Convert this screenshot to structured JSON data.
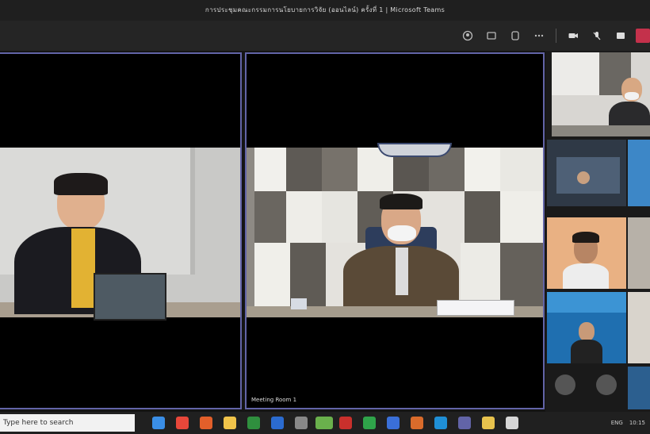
{
  "window": {
    "title": "การประชุมคณะกรรมการนโยบายการวิจัย (ออนไลน์) ครั้งที่ 1 | Microsoft Teams"
  },
  "toolbar": {
    "icons": [
      "participants-icon",
      "chat-icon",
      "reactions-icon",
      "more-icon",
      "camera-icon",
      "mic-icon",
      "share-icon",
      "leave-icon"
    ]
  },
  "main_tiles": [
    {
      "name": ""
    },
    {
      "name": "Meeting Room 1"
    }
  ],
  "taskbar": {
    "search_placeholder": "Type here to search",
    "tray_time": "10:15",
    "tray_lang": "ENG"
  },
  "colors": {
    "accent": "#6264a7",
    "leave": "#c4314b",
    "taskbar": "#202020"
  }
}
